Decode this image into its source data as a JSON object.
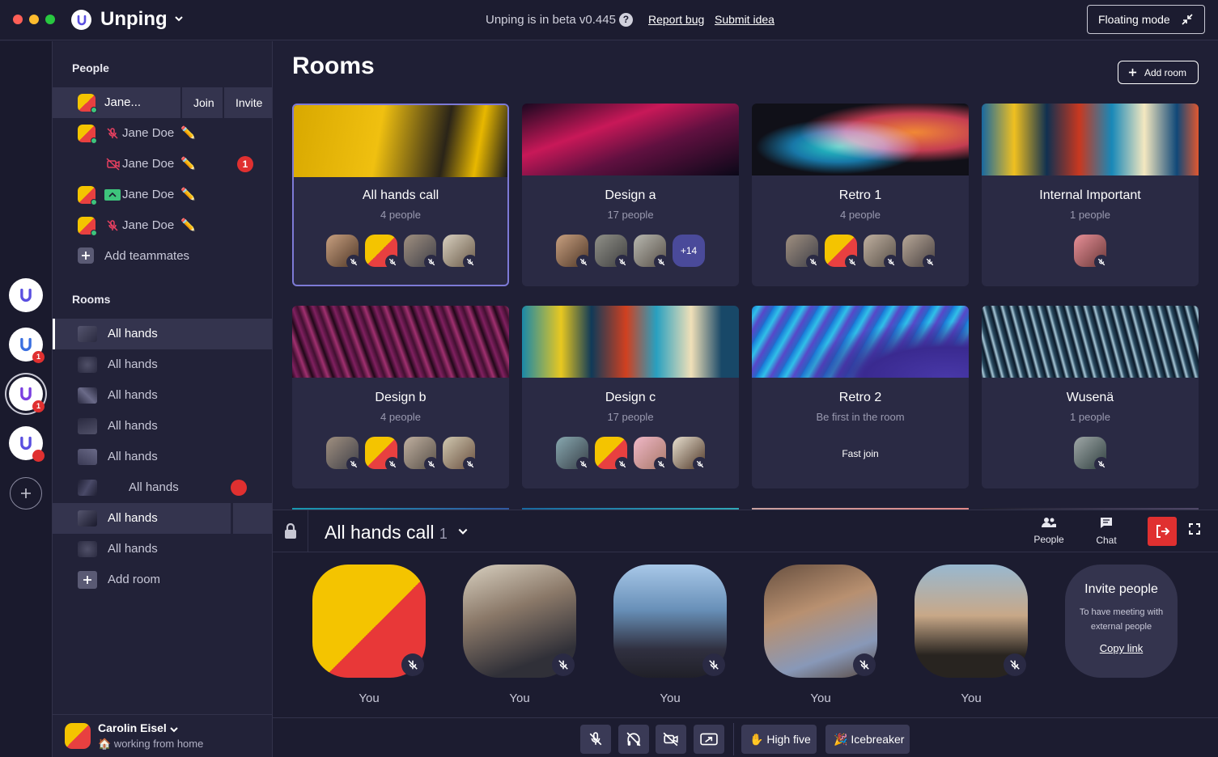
{
  "titlebar": {
    "app_name": "Unping",
    "beta_text": "Unping is in beta v0.445",
    "report_bug": "Report bug",
    "submit_idea": "Submit idea",
    "floating_mode": "Floating mode"
  },
  "workspaces": {
    "badge_1": "1",
    "badge_2": "1"
  },
  "people": {
    "title": "People",
    "items": [
      {
        "name": "Jane...",
        "join": "Join",
        "invite": "Invite"
      },
      {
        "name": "Jane Doe"
      },
      {
        "name": "Jane Doe",
        "badge": "1"
      },
      {
        "name": "Jane Doe"
      },
      {
        "name": "Jane Doe"
      }
    ],
    "add_teammates": "Add teammates"
  },
  "rooms_sidebar": {
    "title": "Rooms",
    "items": [
      "All hands",
      "All hands",
      "All hands",
      "All hands",
      "All hands",
      "All hands",
      "All hands",
      "All hands"
    ],
    "add_room": "Add room"
  },
  "user": {
    "name": "Carolin Eisel",
    "status": "working from home"
  },
  "main": {
    "title": "Rooms",
    "add_room": "Add room",
    "rooms": [
      {
        "name": "All hands call",
        "sub": "4 people"
      },
      {
        "name": "Design a",
        "sub": "17 people",
        "more": "+14"
      },
      {
        "name": "Retro 1",
        "sub": "4 people"
      },
      {
        "name": "Internal Important",
        "sub": "1 people"
      },
      {
        "name": "Design b",
        "sub": "4 people"
      },
      {
        "name": "Design c",
        "sub": "17 people"
      },
      {
        "name": "Retro 2",
        "sub": "Be first in the room",
        "action": "Fast join"
      },
      {
        "name": "Wusenä",
        "sub": "1 people"
      }
    ]
  },
  "call": {
    "title": "All hands call",
    "count": "1",
    "people_label": "People",
    "chat_label": "Chat",
    "participants": [
      "You",
      "You",
      "You",
      "You",
      "You"
    ],
    "invite": {
      "title": "Invite people",
      "desc": "To have meeting with external people",
      "link": "Copy link"
    },
    "high_five": "High five",
    "icebreaker": "Icebreaker"
  },
  "colors": {
    "accent": "#7d7ad6",
    "danger": "#e03030",
    "online": "#3ec47c"
  }
}
